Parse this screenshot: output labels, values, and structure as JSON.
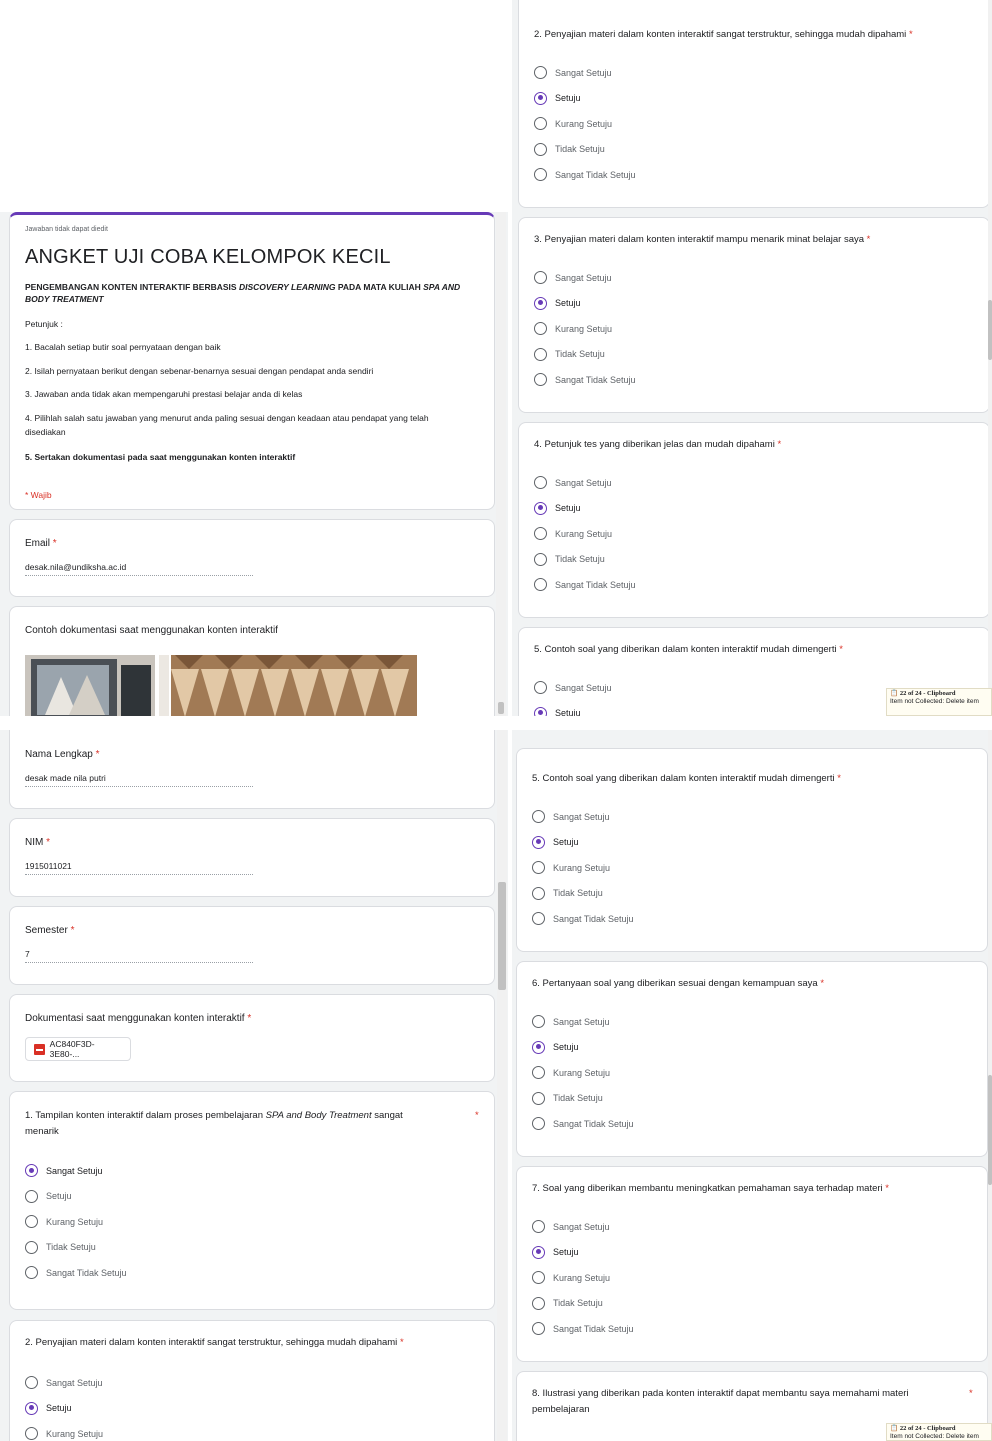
{
  "options": [
    "Sangat Setuju",
    "Setuju",
    "Kurang Setuju",
    "Tidak Setuju",
    "Sangat Tidak Setuju"
  ],
  "required_mark": "*",
  "header": {
    "note": "Jawaban tidak dapat diedit",
    "title": "ANGKET UJI COBA KELOMPOK KECIL",
    "subtitle_a": "PENGEMBANGAN KONTEN INTERAKTIF BERBASIS ",
    "subtitle_b": "DISCOVERY LEARNING",
    "subtitle_c": " PADA MATA KULIAH ",
    "subtitle_d": "SPA AND",
    "subtitle_e": "BODY TREATMENT",
    "petunjuk": "Petunjuk :",
    "instructions": [
      "1. Bacalah setiap butir soal pernyataan dengan baik",
      "2. Isilah pernyataan berikut dengan sebenar-benarnya sesuai dengan pendapat anda sendiri",
      "3. Jawaban anda tidak akan mempengaruhi prestasi belajar anda di kelas",
      "4. Pilihlah salah satu jawaban yang menurut anda paling sesuai dengan keadaan atau pendapat yang telah",
      "disediakan",
      "5. Sertakan dokumentasi pada saat menggunakan konten interaktif"
    ],
    "wajib": "* Wajib"
  },
  "fields": {
    "email": {
      "label": "Email",
      "value": "desak.nila@undiksha.ac.id"
    },
    "nama": {
      "label": "Nama Lengkap",
      "value": "desak made nila putri"
    },
    "nim": {
      "label": "NIM",
      "value": "1915011021"
    },
    "semester": {
      "label": "Semester",
      "value": "7"
    }
  },
  "example_doc": {
    "label": "Contoh dokumentasi saat menggunakan konten interaktif"
  },
  "upload": {
    "label": "Dokumentasi saat menggunakan konten interaktif",
    "file_name": "AC840F3D-3E80-..."
  },
  "questions": {
    "q1": {
      "text_a": "1. Tampilan konten interaktif dalam proses pembelajaran ",
      "text_b": "SPA and Body Treatment",
      "text_c": " sangat",
      "text_d": "menarik",
      "selected": "Sangat Setuju"
    },
    "q2": {
      "text": "2. Penyajian materi dalam konten interaktif sangat terstruktur, sehingga mudah dipahami",
      "selected": "Setuju"
    },
    "q3": {
      "text": "3. Penyajian materi dalam konten interaktif mampu menarik minat belajar saya",
      "selected": "Setuju"
    },
    "q4": {
      "text": "4. Petunjuk tes yang diberikan jelas dan mudah dipahami",
      "selected": "Setuju"
    },
    "q5": {
      "text": "5. Contoh soal yang diberikan dalam konten interaktif mudah dimengerti",
      "selected": "Setuju"
    },
    "q6": {
      "text": "6. Pertanyaan soal yang diberikan sesuai dengan kemampuan saya",
      "selected": "Setuju"
    },
    "q7": {
      "text": "7. Soal yang diberikan membantu meningkatkan pemahaman saya terhadap materi",
      "selected": "Setuju"
    },
    "q8": {
      "text_a": "8. Ilustrasi yang diberikan pada konten interaktif dapat membantu saya memahami materi",
      "text_b": "pembelajaran"
    }
  },
  "clipboard": {
    "title": "22 of 24 - Clipboard",
    "line": "Item not Collected: Delete item"
  },
  "clipboard_top": {
    "line": "Item not Collected: Delete item"
  },
  "colors": {
    "accent": "#673ab7",
    "required": "#d93025",
    "background": "#f1f3f4"
  }
}
